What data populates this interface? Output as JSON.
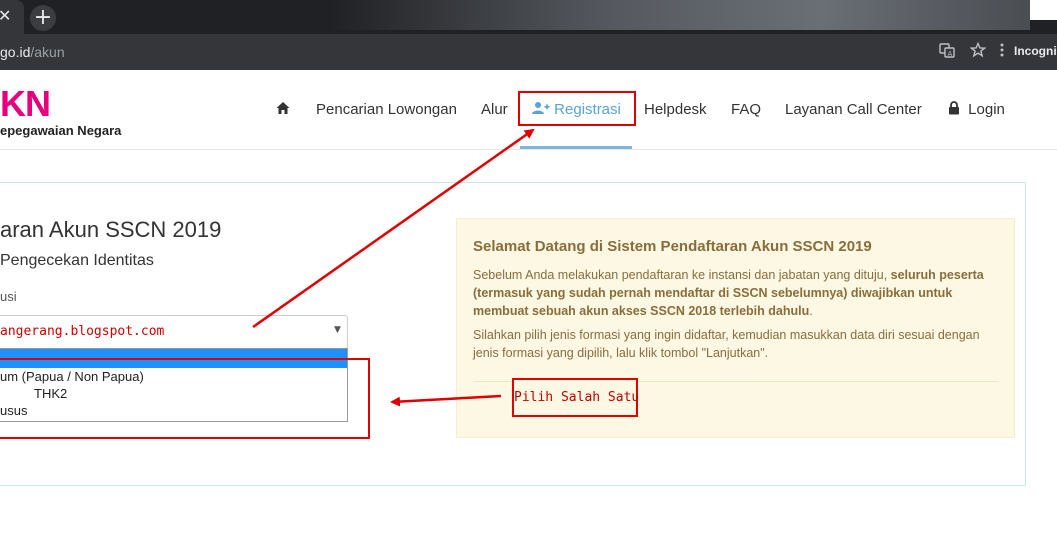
{
  "browser": {
    "close_glyph": "✕",
    "newtab_glyph": "+",
    "url_host": "go.id",
    "url_path": "/akun",
    "incognito_label": "Incogni",
    "translate_icon": "translate-icon",
    "star_icon": "star-icon",
    "menu_icon": "kebab-menu-icon"
  },
  "site": {
    "logo_mark": "KN",
    "logo_sub": "epegawaian Negara",
    "brand_color": "#e6007e"
  },
  "nav": {
    "home_icon": "home-icon",
    "items": [
      {
        "label": "Pencarian Lowongan"
      },
      {
        "label": "Alur"
      },
      {
        "label": "Registrasi",
        "icon": "user-plus-icon"
      },
      {
        "label": "Helpdesk"
      },
      {
        "label": "FAQ"
      },
      {
        "label": "Layanan Call Center"
      },
      {
        "label": "Login",
        "icon": "lock-icon"
      }
    ]
  },
  "form": {
    "title": "aran Akun SSCN 2019",
    "subtitle": "Pengecekan Identitas",
    "field_label": "usi",
    "select_value": "angerang.blogspot.com",
    "options": [
      "",
      "um (Papua / Non Papua)",
      "THK2",
      "usus"
    ]
  },
  "info": {
    "title": "Selamat Datang di Sistem Pendaftaran Akun SSCN 2019",
    "p1_normal": "Sebelum Anda melakukan pendaftaran ke instansi dan jabatan yang dituju, ",
    "p1_bold": "seluruh peserta (termasuk yang sudah pernah mendaftar di SSCN sebelumnya) diwajibkan untuk membuat sebuah akun akses SSCN 2018 terlebih dahulu",
    "p1_end": ".",
    "p2": "Silahkan pilih jenis formasi yang ingin didaftar, kemudian masukkan data diri sesuai dengan jenis formasi yang dipilih, lalu klik tombol \"Lanjutkan\"."
  },
  "annotation": {
    "label": "Pilih Salah Satu",
    "color": "#e00000"
  }
}
